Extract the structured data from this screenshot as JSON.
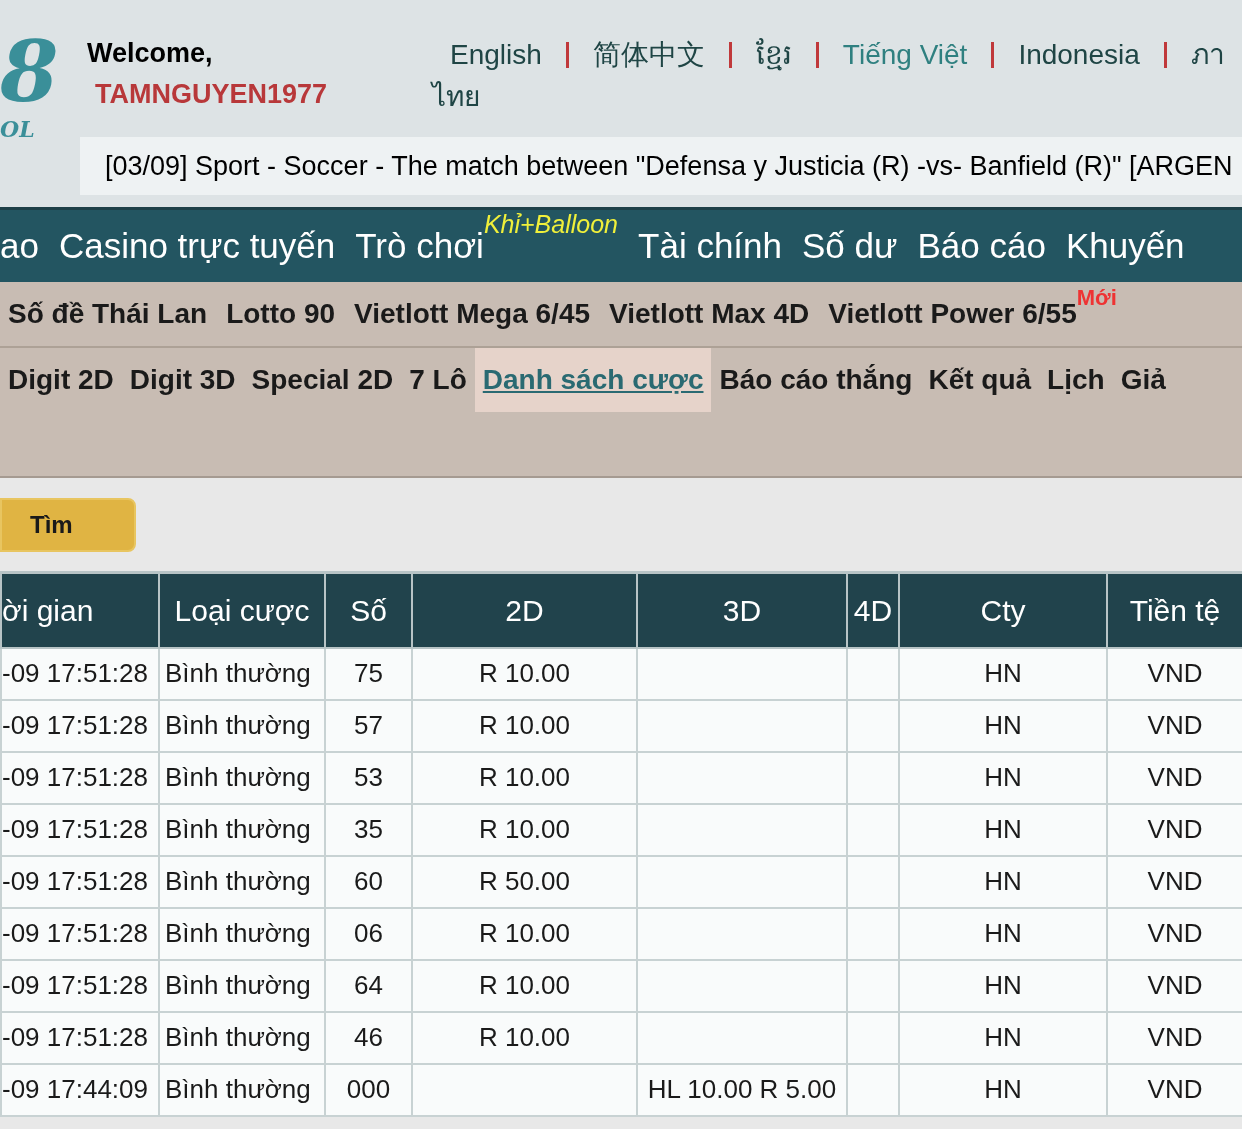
{
  "logo": {
    "mark": "8",
    "text": "OL"
  },
  "welcome": {
    "greeting": "Welcome,",
    "username": "TAMNGUYEN1977"
  },
  "languages": [
    {
      "label": "English",
      "selected": false
    },
    {
      "label": "简体中文",
      "selected": false
    },
    {
      "label": "ខ្មែរ",
      "selected": false
    },
    {
      "label": "Tiếng Việt",
      "selected": true
    },
    {
      "label": "Indonesia",
      "selected": false
    },
    {
      "label": "ภา",
      "selected": false
    },
    {
      "label": "ไทย",
      "selected": false
    }
  ],
  "ticker": "[03/09] Sport - Soccer - The match between \"Defensa y Justicia (R) -vs- Banfield (R)\" [ARGEN",
  "main_nav": [
    {
      "label": "ao"
    },
    {
      "label": "Casino trực tuyến"
    },
    {
      "label": "Trò chơi",
      "badge": "Khỉ+Balloon"
    },
    {
      "label": "Tài chính"
    },
    {
      "label": "Số dư"
    },
    {
      "label": "Báo cáo"
    },
    {
      "label": "Khuyến"
    }
  ],
  "games_nav": [
    {
      "label": "Số đề Thái Lan"
    },
    {
      "label": "Lotto 90"
    },
    {
      "label": "Vietlott Mega 6/45"
    },
    {
      "label": "Vietlott Max 4D"
    },
    {
      "label": "Vietlott Power 6/55",
      "badge": "Mới"
    }
  ],
  "sub_nav": [
    {
      "label": "Digit 2D",
      "selected": false
    },
    {
      "label": "Digit 3D",
      "selected": false
    },
    {
      "label": "Special 2D",
      "selected": false
    },
    {
      "label": "7 Lô",
      "selected": false
    },
    {
      "label": "Danh sách cược",
      "selected": true
    },
    {
      "label": "Báo cáo thắng",
      "selected": false
    },
    {
      "label": "Kết quả",
      "selected": false
    },
    {
      "label": "Lịch",
      "selected": false
    },
    {
      "label": "Giả",
      "selected": false
    }
  ],
  "search_button": "Tìm",
  "table": {
    "columns": [
      "ời gian",
      "Loại cược",
      "Số",
      "2D",
      "3D",
      "4D",
      "Cty",
      "Tiền tệ"
    ],
    "rows": [
      [
        "-09 17:51:28",
        "Bình thường",
        "75",
        "R 10.00",
        "",
        "",
        "HN",
        "VND"
      ],
      [
        "-09 17:51:28",
        "Bình thường",
        "57",
        "R 10.00",
        "",
        "",
        "HN",
        "VND"
      ],
      [
        "-09 17:51:28",
        "Bình thường",
        "53",
        "R 10.00",
        "",
        "",
        "HN",
        "VND"
      ],
      [
        "-09 17:51:28",
        "Bình thường",
        "35",
        "R 10.00",
        "",
        "",
        "HN",
        "VND"
      ],
      [
        "-09 17:51:28",
        "Bình thường",
        "60",
        "R 50.00",
        "",
        "",
        "HN",
        "VND"
      ],
      [
        "-09 17:51:28",
        "Bình thường",
        "06",
        "R 10.00",
        "",
        "",
        "HN",
        "VND"
      ],
      [
        "-09 17:51:28",
        "Bình thường",
        "64",
        "R 10.00",
        "",
        "",
        "HN",
        "VND"
      ],
      [
        "-09 17:51:28",
        "Bình thường",
        "46",
        "R 10.00",
        "",
        "",
        "HN",
        "VND"
      ],
      [
        "-09 17:44:09",
        "Bình thường",
        "000",
        "",
        "HL 10.00 R 5.00",
        "",
        "HN",
        "VND"
      ]
    ]
  }
}
